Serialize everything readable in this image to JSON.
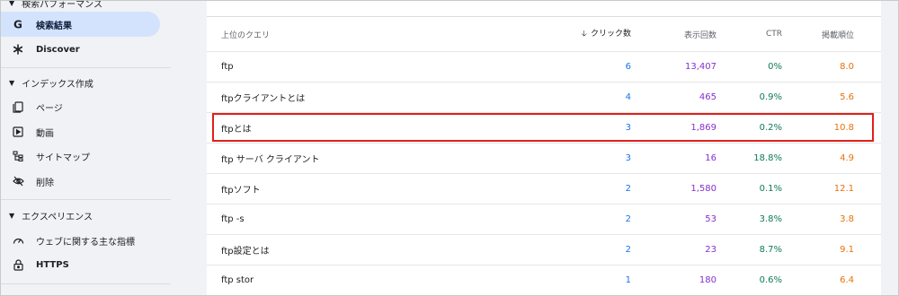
{
  "sidebar": {
    "top_section_label": "検索パフォーマンス",
    "items_search": [
      {
        "label": "検索結果",
        "icon": "google-g-icon",
        "active": true
      },
      {
        "label": "Discover",
        "icon": "asterisk-icon",
        "active": false
      }
    ],
    "index_section_label": "インデックス作成",
    "items_index": [
      {
        "label": "ページ",
        "icon": "pages-icon"
      },
      {
        "label": "動画",
        "icon": "video-icon"
      },
      {
        "label": "サイトマップ",
        "icon": "sitemap-icon"
      },
      {
        "label": "削除",
        "icon": "eye-off-icon"
      }
    ],
    "experience_section_label": "エクスペリエンス",
    "items_experience": [
      {
        "label": "ウェブに関する主な指標",
        "icon": "gauge-icon"
      },
      {
        "label": "HTTPS",
        "icon": "lock-icon"
      }
    ]
  },
  "table": {
    "headers": {
      "query": "上位のクエリ",
      "clicks": "クリック数",
      "impressions": "表示回数",
      "ctr": "CTR",
      "position": "掲載順位"
    },
    "sort_icon": "arrow-down-icon",
    "rows": [
      {
        "query": "ftp",
        "clicks": "6",
        "impressions": "13,407",
        "ctr": "0%",
        "position": "8.0"
      },
      {
        "query": "ftpクライアントとは",
        "clicks": "4",
        "impressions": "465",
        "ctr": "0.9%",
        "position": "5.6"
      },
      {
        "query": "ftpとは",
        "clicks": "3",
        "impressions": "1,869",
        "ctr": "0.2%",
        "position": "10.8"
      },
      {
        "query": "ftp サーバ クライアント",
        "clicks": "3",
        "impressions": "16",
        "ctr": "18.8%",
        "position": "4.9"
      },
      {
        "query": "ftpソフト",
        "clicks": "2",
        "impressions": "1,580",
        "ctr": "0.1%",
        "position": "12.1"
      },
      {
        "query": "ftp -s",
        "clicks": "2",
        "impressions": "53",
        "ctr": "3.8%",
        "position": "3.8"
      },
      {
        "query": "ftp設定とは",
        "clicks": "2",
        "impressions": "23",
        "ctr": "8.7%",
        "position": "9.1"
      },
      {
        "query": "ftp stor",
        "clicks": "1",
        "impressions": "180",
        "ctr": "0.6%",
        "position": "6.4"
      }
    ]
  },
  "colors": {
    "clicks": "#1a73e8",
    "impressions": "#8430ce",
    "ctr": "#0e7a5a",
    "position": "#e8710a",
    "highlight_box": "#e0201a",
    "active_item_bg": "#d3e3fd"
  }
}
